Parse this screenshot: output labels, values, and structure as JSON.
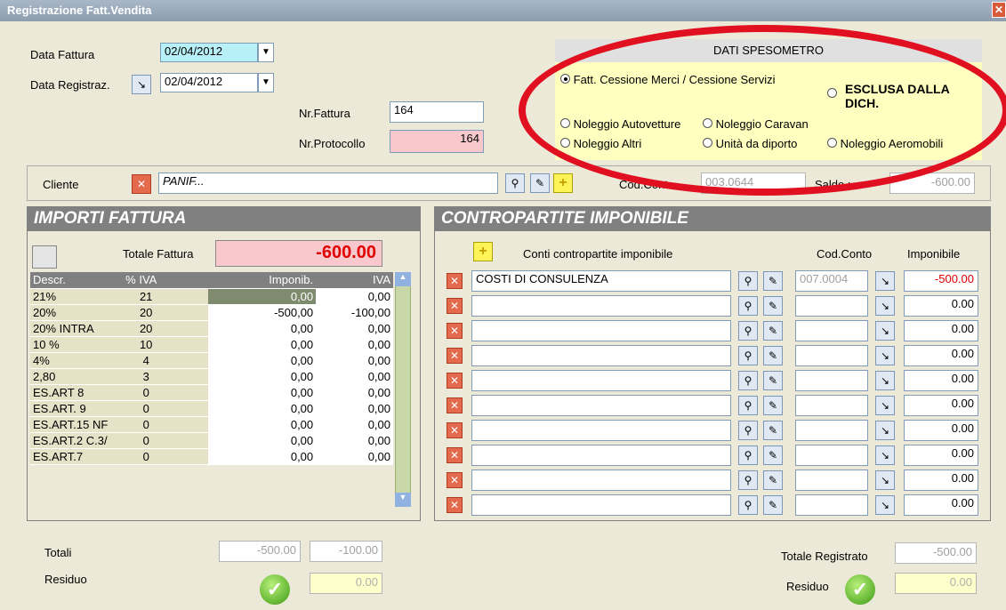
{
  "window": {
    "title": "Registrazione Fatt.Vendita"
  },
  "header": {
    "data_fattura_label": "Data Fattura",
    "data_fattura_value": "02/04/2012",
    "data_registraz_label": "Data Registraz.",
    "data_registraz_value": "02/04/2012",
    "nr_fattura_label": "Nr.Fattura",
    "nr_fattura_value": "164",
    "nr_protocollo_label": "Nr.Protocollo",
    "nr_protocollo_value": "164"
  },
  "spesometro": {
    "title": "DATI SPESOMETRO",
    "opt_cessione": "Fatt. Cessione Merci / Cessione Servizi",
    "opt_esclusa": "ESCLUSA DALLA DICH.",
    "opt_autovetture": "Noleggio Autovetture",
    "opt_caravan": "Noleggio Caravan",
    "opt_altri": "Noleggio Altri",
    "opt_diporto": "Unità da diporto",
    "opt_aeromobili": "Noleggio Aeromobili"
  },
  "cliente": {
    "label": "Cliente",
    "value": "PANIF...",
    "cod_conto_label": "Cod.Conto",
    "cod_conto_value": "003.0644",
    "saldo_label": "Saldo :",
    "saldo_value": "-600.00"
  },
  "importi": {
    "title": "IMPORTI FATTURA",
    "totale_label": "Totale Fattura",
    "totale_value": "-600.00",
    "headers": {
      "descr": "Descr.",
      "iva_pct": "% IVA",
      "imponib": "Imponib.",
      "iva": "IVA"
    },
    "rows": [
      {
        "descr": "21%",
        "pct": "21",
        "imponib": "0,00",
        "iva": "0,00"
      },
      {
        "descr": "20%",
        "pct": "20",
        "imponib": "-500,00",
        "iva": "-100,00"
      },
      {
        "descr": "20% INTRA",
        "pct": "20",
        "imponib": "0,00",
        "iva": "0,00"
      },
      {
        "descr": "10 %",
        "pct": "10",
        "imponib": "0,00",
        "iva": "0,00"
      },
      {
        "descr": "4%",
        "pct": "4",
        "imponib": "0,00",
        "iva": "0,00"
      },
      {
        "descr": "2,80",
        "pct": "3",
        "imponib": "0,00",
        "iva": "0,00"
      },
      {
        "descr": "ES.ART 8",
        "pct": "0",
        "imponib": "0,00",
        "iva": "0,00"
      },
      {
        "descr": "ES.ART. 9",
        "pct": "0",
        "imponib": "0,00",
        "iva": "0,00"
      },
      {
        "descr": "ES.ART.15 NF",
        "pct": "0",
        "imponib": "0,00",
        "iva": "0,00"
      },
      {
        "descr": "ES.ART.2 C.3/",
        "pct": "0",
        "imponib": "0,00",
        "iva": "0,00"
      },
      {
        "descr": "ES.ART.7",
        "pct": "0",
        "imponib": "0,00",
        "iva": "0,00"
      }
    ],
    "totali_label": "Totali",
    "totali_imponib": "-500.00",
    "totali_iva": "-100.00",
    "residuo_label": "Residuo",
    "residuo_value": "0.00"
  },
  "contropartite": {
    "title": "CONTROPARTITE IMPONIBILE",
    "conti_label": "Conti contropartite imponibile",
    "cod_conto_label": "Cod.Conto",
    "imponibile_label": "Imponibile",
    "rows": [
      {
        "descr": "COSTI DI CONSULENZA",
        "cod": "007.0004",
        "imp": "-500.00"
      },
      {
        "descr": "",
        "cod": "",
        "imp": "0.00"
      },
      {
        "descr": "",
        "cod": "",
        "imp": "0.00"
      },
      {
        "descr": "",
        "cod": "",
        "imp": "0.00"
      },
      {
        "descr": "",
        "cod": "",
        "imp": "0.00"
      },
      {
        "descr": "",
        "cod": "",
        "imp": "0.00"
      },
      {
        "descr": "",
        "cod": "",
        "imp": "0.00"
      },
      {
        "descr": "",
        "cod": "",
        "imp": "0.00"
      },
      {
        "descr": "",
        "cod": "",
        "imp": "0.00"
      },
      {
        "descr": "",
        "cod": "",
        "imp": "0.00"
      }
    ],
    "totale_registrato_label": "Totale Registrato",
    "totale_registrato_value": "-500.00",
    "residuo_label": "Residuo",
    "residuo_value": "0.00"
  },
  "colors": {
    "pink": "#f8c8cc",
    "yellow_panel": "#ffffc0",
    "header_gray": "#808080",
    "red_text": "#e00000"
  }
}
